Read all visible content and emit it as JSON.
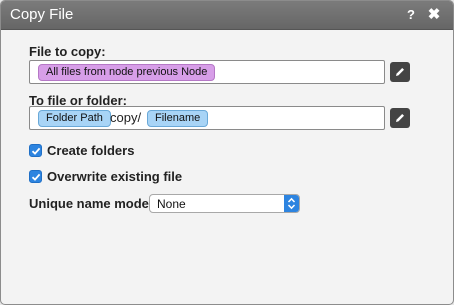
{
  "window": {
    "title": "Copy File",
    "help_label": "?",
    "close_label": "✖"
  },
  "file_to_copy": {
    "label": "File to copy:",
    "token": "All files from node previous Node",
    "edit_icon": "pencil-icon"
  },
  "destination": {
    "label": "To file or folder:",
    "token1": "Folder Path",
    "separator": "copy/",
    "token2": "Filename",
    "edit_icon": "pencil-icon"
  },
  "options": {
    "create_folders": {
      "label": "Create folders",
      "checked": true
    },
    "overwrite": {
      "label": "Overwrite existing file",
      "checked": true
    }
  },
  "unique_name_mode": {
    "label": "Unique name mode:",
    "value": "None"
  },
  "colors": {
    "accent": "#2d84e0",
    "token_purple": "#d79ee8",
    "token_blue": "#a8d4f6",
    "titlebar": "#707070"
  }
}
